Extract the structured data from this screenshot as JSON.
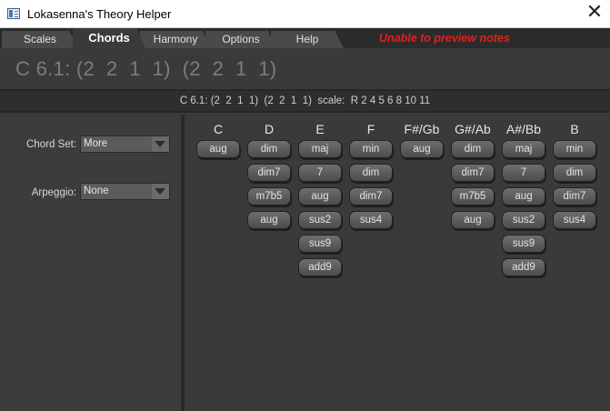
{
  "window": {
    "title": "Lokasenna's Theory Helper",
    "close_glyph": "✕"
  },
  "tabs": [
    {
      "label": "Scales"
    },
    {
      "label": "Chords"
    },
    {
      "label": "Harmony"
    },
    {
      "label": "Options"
    },
    {
      "label": "Help"
    }
  ],
  "active_tab": "Chords",
  "warning": "Unable to preview notes",
  "chord_title": "C 6.1: (2  2  1  1)  (2  2  1  1)",
  "info_line": "C 6.1: (2  2  1  1)  (2  2  1  1)  scale:  R 2 4 5 6 8 10 11",
  "left_panel": {
    "chord_set": {
      "label": "Chord Set:",
      "value": "More"
    },
    "arpeggio": {
      "label": "Arpeggio:",
      "value": "None"
    }
  },
  "columns": [
    {
      "note": "C",
      "chords": [
        "aug"
      ]
    },
    {
      "note": "D",
      "chords": [
        "dim",
        "dim7",
        "m7b5",
        "aug"
      ]
    },
    {
      "note": "E",
      "chords": [
        "maj",
        "7",
        "aug",
        "sus2",
        "sus9",
        "add9"
      ]
    },
    {
      "note": "F",
      "chords": [
        "min",
        "dim",
        "dim7",
        "sus4"
      ]
    },
    {
      "note": "F#/Gb",
      "chords": [
        "aug"
      ]
    },
    {
      "note": "G#/Ab",
      "chords": [
        "dim",
        "dim7",
        "m7b5",
        "aug"
      ]
    },
    {
      "note": "A#/Bb",
      "chords": [
        "maj",
        "7",
        "aug",
        "sus2",
        "sus9",
        "add9"
      ]
    },
    {
      "note": "B",
      "chords": [
        "min",
        "dim",
        "dim7",
        "sus4"
      ]
    }
  ],
  "colors": {
    "warning": "#e02020",
    "background": "#3a3a3a",
    "button": "#5e5e5e"
  }
}
